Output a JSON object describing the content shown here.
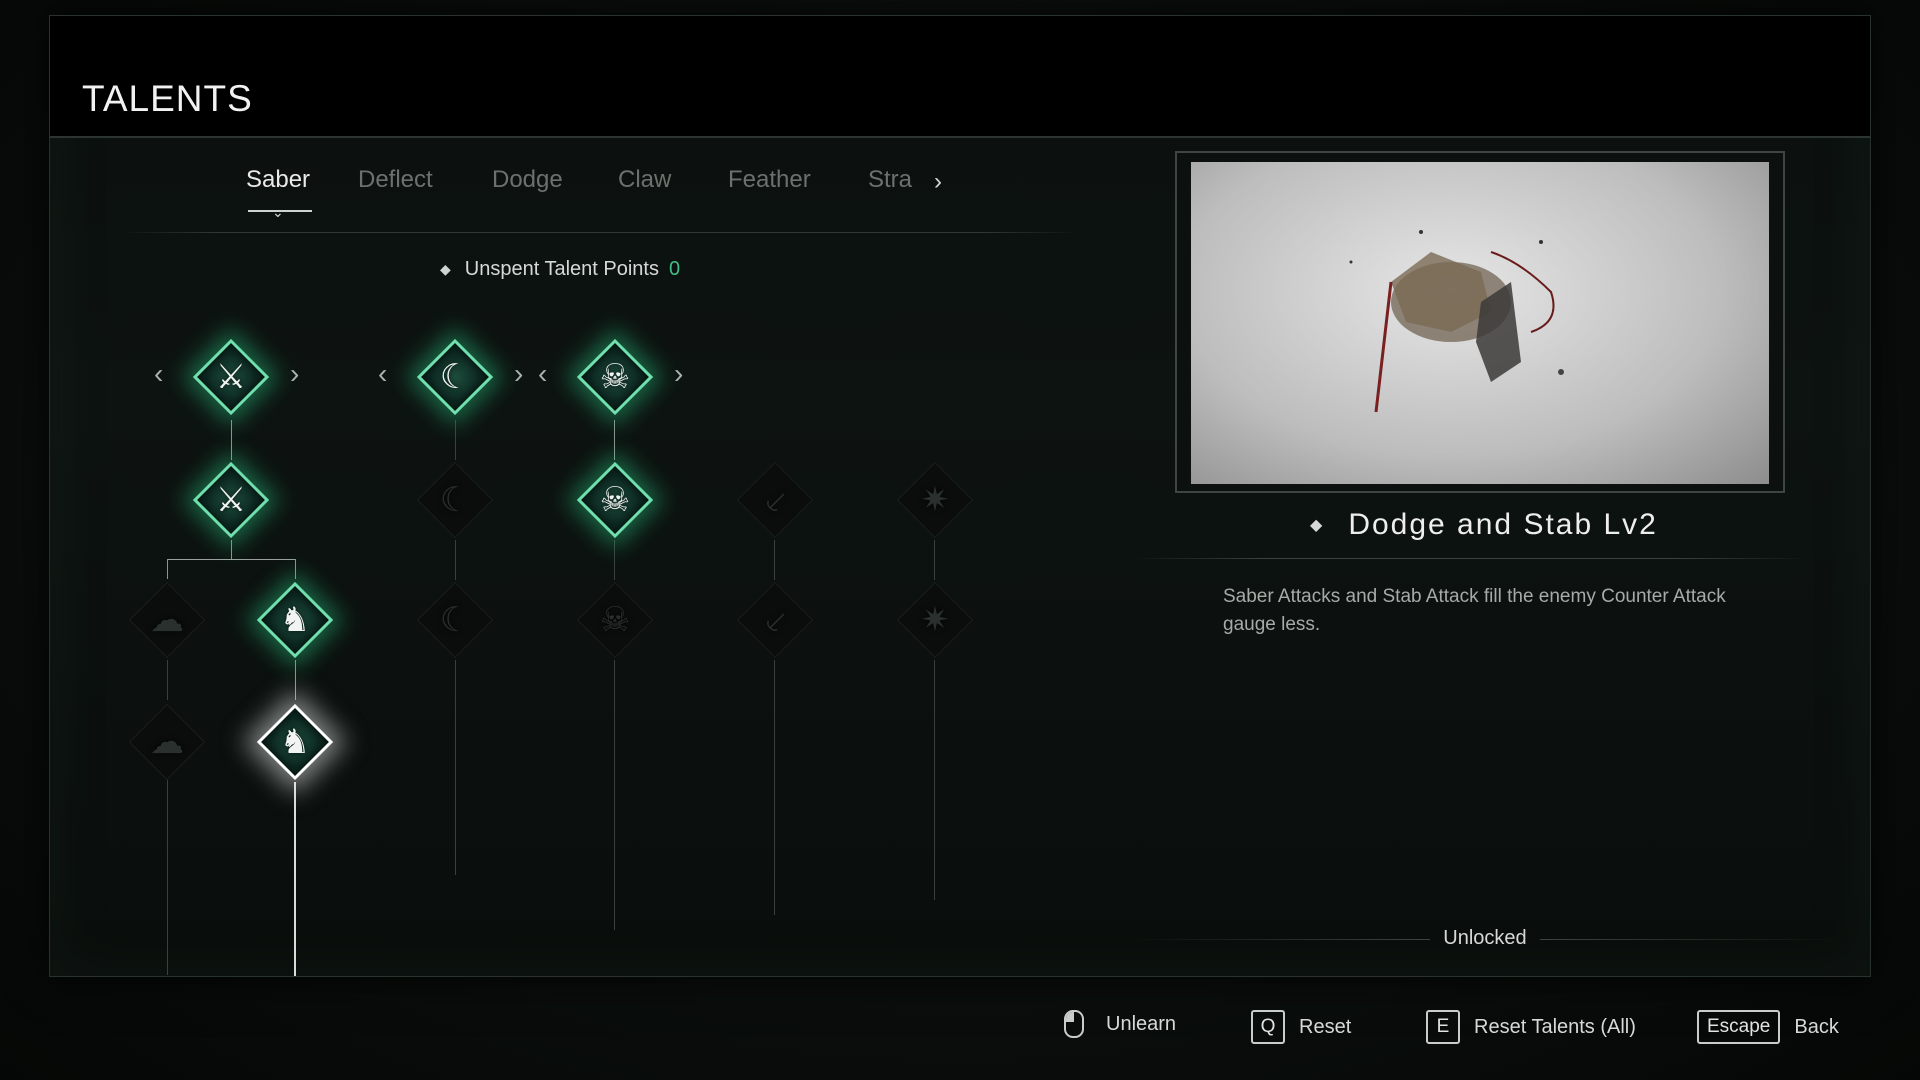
{
  "header": {
    "title": "TALENTS"
  },
  "tabs": [
    {
      "label": "Saber",
      "active": true
    },
    {
      "label": "Deflect",
      "active": false
    },
    {
      "label": "Dodge",
      "active": false
    },
    {
      "label": "Claw",
      "active": false
    },
    {
      "label": "Feather",
      "active": false
    },
    {
      "label": "Stra",
      "active": false
    }
  ],
  "tabs_more_icon": "chevron-right-icon",
  "points": {
    "label": "Unspent Talent Points",
    "value": "0"
  },
  "selected_skill": {
    "name": "Dodge and Stab Lv2",
    "description": "Saber Attacks and Stab Attack fill the enemy Counter Attack gauge less.",
    "status": "Unlocked"
  },
  "footer": {
    "unlearn": {
      "icon": "mouse-left-icon",
      "label": "Unlearn"
    },
    "reset": {
      "key": "Q",
      "label": "Reset"
    },
    "reset_all": {
      "key": "E",
      "label": "Reset Talents (All)"
    },
    "back": {
      "key": "Escape",
      "label": "Back"
    }
  },
  "colors": {
    "accent_green": "#3fbf84",
    "node_glow": "#6fe0ae",
    "selected_glow": "#ffffff"
  },
  "tree_nodes": [
    {
      "id": "saber-1",
      "icon": "saber-slash-icon",
      "state": "active"
    },
    {
      "id": "saber-2",
      "icon": "saber-slash-icon",
      "state": "active"
    },
    {
      "id": "saber-3a",
      "icon": "cloak-icon",
      "state": "locked"
    },
    {
      "id": "saber-3b",
      "icon": "dodge-stab-icon",
      "state": "active"
    },
    {
      "id": "saber-4a",
      "icon": "cloak-icon",
      "state": "locked"
    },
    {
      "id": "saber-4b",
      "icon": "dodge-stab-icon",
      "state": "selected"
    },
    {
      "id": "blade-1",
      "icon": "blade-icon",
      "state": "active"
    },
    {
      "id": "blade-2",
      "icon": "blade-icon",
      "state": "locked"
    },
    {
      "id": "blade-3",
      "icon": "blade-icon",
      "state": "locked"
    },
    {
      "id": "skull-1",
      "icon": "skull-icon",
      "state": "active"
    },
    {
      "id": "skull-2",
      "icon": "skull-icon",
      "state": "active"
    },
    {
      "id": "skull-3",
      "icon": "skull-icon",
      "state": "locked"
    },
    {
      "id": "sword-1",
      "icon": "sword-icon",
      "state": "locked"
    },
    {
      "id": "sword-2",
      "icon": "sword-icon",
      "state": "locked"
    },
    {
      "id": "burst-1",
      "icon": "burst-icon",
      "state": "locked"
    },
    {
      "id": "burst-2",
      "icon": "burst-icon",
      "state": "locked"
    }
  ]
}
